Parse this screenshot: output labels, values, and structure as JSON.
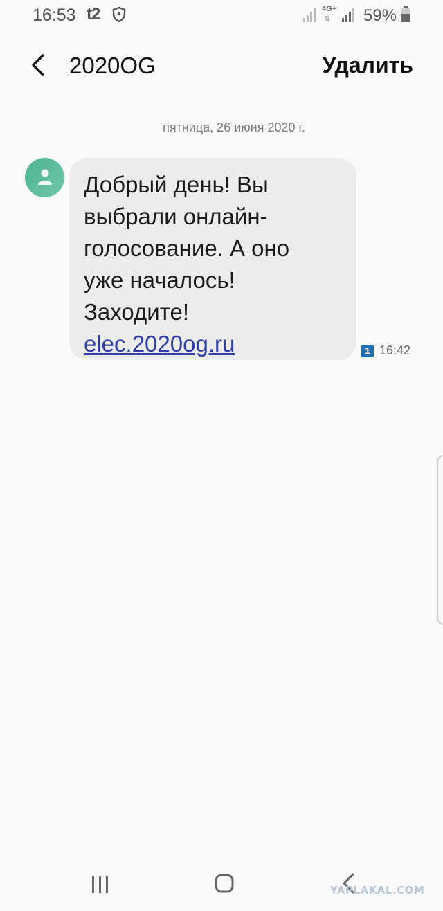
{
  "status_bar": {
    "time": "16:53",
    "carrier": "t2",
    "network": "4G+",
    "network_arrows": "⇅",
    "battery_percent": "59%"
  },
  "header": {
    "title": "2020OG",
    "delete_label": "Удалить"
  },
  "conversation": {
    "date_separator": "пятница, 26 июня 2020 г.",
    "messages": [
      {
        "text": "Добрый день! Вы выбрали онлайн-голосование. А оно уже началось! Заходите! ",
        "link": "elec.2020og.ru",
        "time": "16:42",
        "sim": "1"
      }
    ]
  },
  "watermark": "YAPLAKAL.COM",
  "icons": [
    "back-icon",
    "shield-icon",
    "signal-icon",
    "battery-icon",
    "avatar-person-icon",
    "recents-icon",
    "home-icon",
    "nav-back-icon"
  ]
}
